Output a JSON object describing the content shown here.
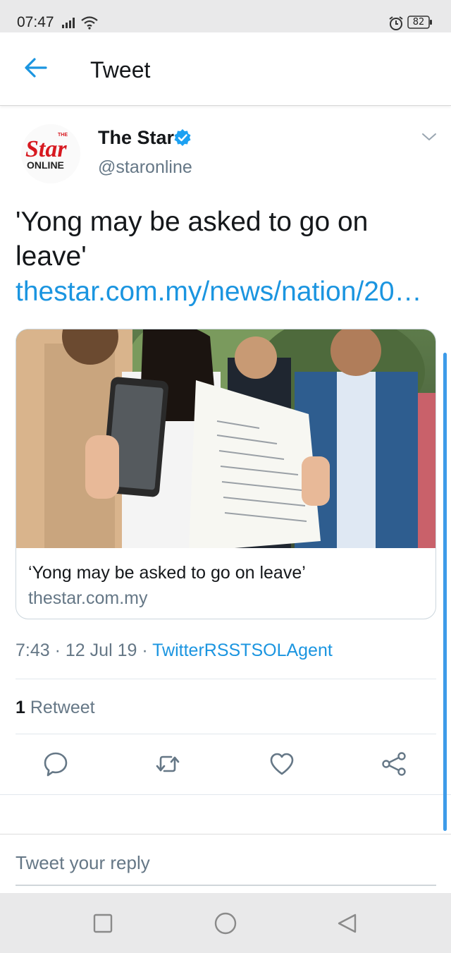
{
  "status_bar": {
    "time": "07:47",
    "battery": "82"
  },
  "header": {
    "title": "Tweet"
  },
  "tweet": {
    "author_name": "The Star",
    "author_handle": "@staronline",
    "avatar_logo": {
      "top": "THE",
      "brand": "Star",
      "sub": "ONLINE"
    },
    "text": "'Yong may be asked to go on leave'",
    "link": "thestar.com.my/news/nation/20…",
    "card": {
      "title": "‘Yong may be asked to go on leave’",
      "domain": "thestar.com.my"
    },
    "time": "7:43",
    "date": "12 Jul 19",
    "source": "TwitterRSSTSOLAgent",
    "retweet_count": "1",
    "retweet_label": "Retweet"
  },
  "reply": {
    "placeholder": "Tweet your reply"
  },
  "icons": {
    "back": "back-arrow-icon",
    "verified": "verified-badge-icon",
    "caret": "chevron-down-icon",
    "reply": "reply-icon",
    "retweet": "retweet-icon",
    "like": "heart-icon",
    "share": "share-icon"
  },
  "colors": {
    "accent": "#1b95e0",
    "text": "#14171a",
    "secondary": "#657786",
    "brand_red": "#d71920"
  }
}
